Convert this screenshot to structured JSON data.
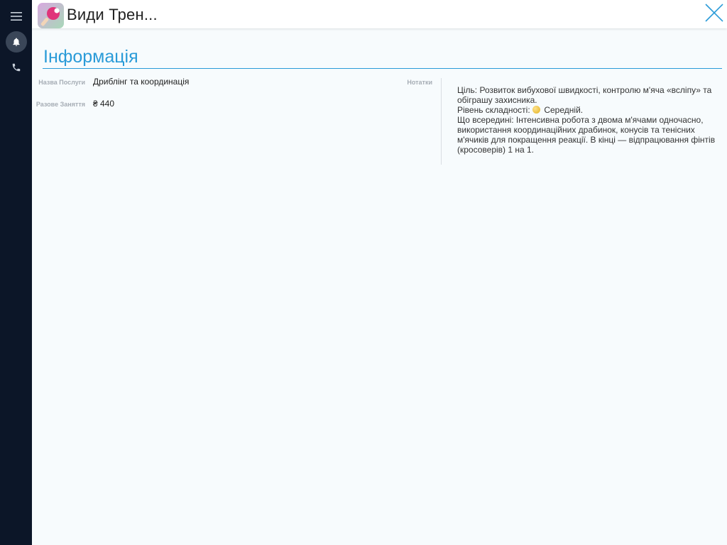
{
  "header": {
    "title": "Види Трен...",
    "close_label": "close"
  },
  "sidebar": {
    "items": [
      {
        "icon": "menu-icon"
      },
      {
        "icon": "bell-icon"
      },
      {
        "icon": "phone-icon"
      }
    ]
  },
  "section": {
    "title": "Інформація"
  },
  "fields": {
    "service_name_label": "Назва Послуги",
    "service_name_value": "Дриблінг та координація",
    "single_session_label": "Разове Заняття",
    "single_session_value": "₴ 440",
    "notes_label": "Нотатки"
  },
  "notes": {
    "line1": "Ціль: Розвиток вибухової швидкості, контролю м'яча «всліпу» та обіграшу захисника.",
    "level_prefix": "Рівень складності:",
    "level_value": "Середній.",
    "line3": "Що всередині: Інтенсивна робота з двома м'ячами одночасно, використання координаційних драбинок, конусів та тенісних м'ячиків для покращення реакції. В кінці — відпрацювання фінтів (кросоверів) 1 на 1."
  },
  "colors": {
    "sidebar_bg": "#0c1628",
    "accent": "#2a9bd8",
    "page_bg": "#f7fbfd"
  }
}
